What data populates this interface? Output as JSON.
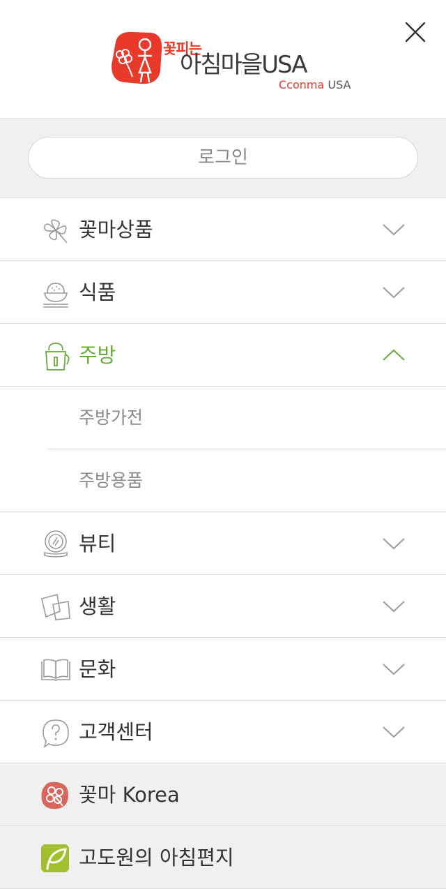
{
  "header": {
    "logo_small_text": "꽃피는",
    "logo_main_text": "아침마을USA",
    "logo_sub_cconma": "Cconma",
    "logo_sub_usa": "USA"
  },
  "login": {
    "label": "로그인"
  },
  "menu": [
    {
      "label": "꽃마상품",
      "icon": "flower-icon",
      "state": "collapsed"
    },
    {
      "label": "식품",
      "icon": "rice-bowl-icon",
      "state": "collapsed"
    },
    {
      "label": "주방",
      "icon": "kettle-icon",
      "state": "expanded",
      "children": [
        {
          "label": "주방가전"
        },
        {
          "label": "주방용품"
        }
      ]
    },
    {
      "label": "뷰티",
      "icon": "compact-mirror-icon",
      "state": "collapsed"
    },
    {
      "label": "생활",
      "icon": "towels-icon",
      "state": "collapsed"
    },
    {
      "label": "문화",
      "icon": "book-icon",
      "state": "collapsed"
    },
    {
      "label": "고객센터",
      "icon": "help-bubble-icon",
      "state": "collapsed"
    }
  ],
  "links": [
    {
      "label": "꽃마 Korea",
      "icon": "cconma-korea-icon",
      "color": "#d9665a"
    },
    {
      "label": "고도원의 아침편지",
      "icon": "leaf-icon",
      "color": "#a3bf2f"
    }
  ],
  "colors": {
    "accent_green": "#6aaa3a",
    "brand_red": "#e8392a",
    "gray_icon": "#9a9a9a"
  }
}
